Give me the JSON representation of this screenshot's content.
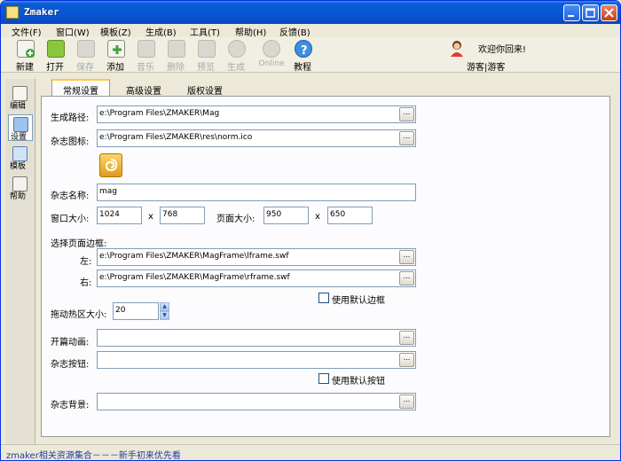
{
  "window": {
    "title": "Zmaker"
  },
  "menu": [
    "文件(F)",
    "窗口(W)",
    "模板(Z)",
    "生成(B)",
    "工具(T)",
    "帮助(H)",
    "反馈(B)"
  ],
  "toolbar": [
    {
      "label": "新建",
      "icon": "new-doc-icon",
      "enabled": true
    },
    {
      "label": "打开",
      "icon": "open-folder-icon",
      "enabled": true
    },
    {
      "label": "保存",
      "icon": "save-disk-icon",
      "enabled": false
    },
    {
      "label": "添加",
      "icon": "add-page-icon",
      "enabled": true
    },
    {
      "label": "音乐",
      "icon": "music-note-icon",
      "enabled": false
    },
    {
      "label": "删除",
      "icon": "delete-icon",
      "enabled": false
    },
    {
      "label": "预览",
      "icon": "preview-star-icon",
      "enabled": false
    },
    {
      "label": "生成",
      "icon": "generate-icon",
      "enabled": false
    },
    {
      "label": "Online",
      "icon": "online-icon",
      "enabled": false
    },
    {
      "label": "教程",
      "icon": "help-icon",
      "enabled": true
    }
  ],
  "user": {
    "welcome": "欢迎你回来!",
    "name": "游客|游客"
  },
  "sidebar": [
    {
      "label": "编辑",
      "icon": "edit-pencil-icon"
    },
    {
      "label": "设置",
      "icon": "settings-icon"
    },
    {
      "label": "模板",
      "icon": "template-icon"
    },
    {
      "label": "帮助",
      "icon": "help-book-icon"
    }
  ],
  "tabs": [
    "常规设置",
    "高级设置",
    "版权设置"
  ],
  "form": {
    "output_path": {
      "label": "生成路径:",
      "value": "e:\\Program Files\\ZMAKER\\Mag"
    },
    "mag_icon": {
      "label": "杂志图标:",
      "value": "e:\\Program Files\\ZMAKER\\res\\norm.ico"
    },
    "mag_name": {
      "label": "杂志名称:",
      "value": "mag"
    },
    "window_size": {
      "label": "窗口大小:",
      "width": "1024",
      "height": "768",
      "sep": "x"
    },
    "page_size": {
      "label": "页面大小:",
      "width": "950",
      "height": "650",
      "sep": "x"
    },
    "frame_section": "选择页面边框:",
    "frame_left": {
      "label": "左:",
      "value": "e:\\Program Files\\ZMAKER\\MagFrame\\lframe.swf"
    },
    "frame_right": {
      "label": "右:",
      "value": "e:\\Program Files\\ZMAKER\\MagFrame\\rframe.swf"
    },
    "use_default_frame": "使用默认边框",
    "hotzone": {
      "label": "拖动热区大小:",
      "value": "20"
    },
    "intro_anim": {
      "label": "开篇动画:",
      "value": ""
    },
    "mag_buttons": {
      "label": "杂志按钮:",
      "value": ""
    },
    "use_default_buttons": "使用默认按钮",
    "mag_background": {
      "label": "杂志背景:",
      "value": ""
    },
    "browse_glyph": "..."
  },
  "status": "zmaker相关资源集合－－－新手初来优先看"
}
